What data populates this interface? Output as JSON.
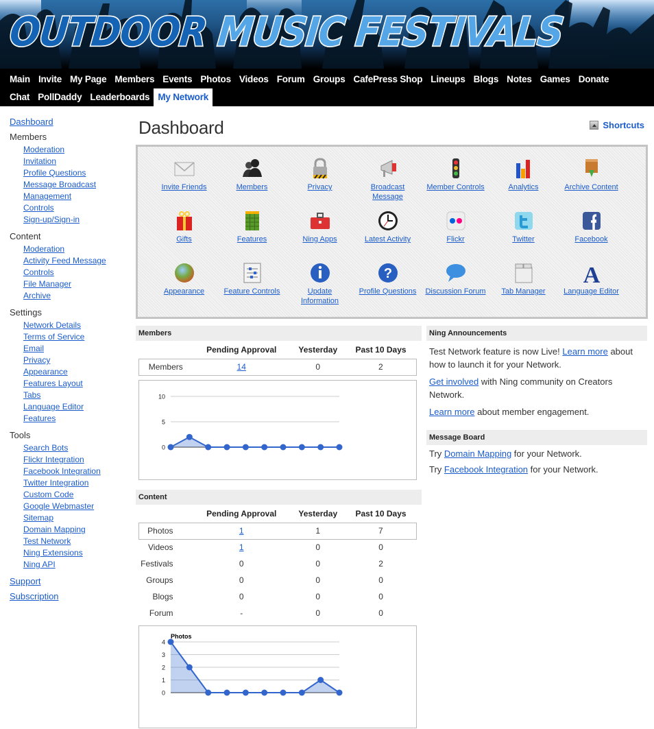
{
  "site": {
    "logo_word1": "OUTDOOR",
    "logo_word2": "MUSIC FESTIVALS",
    "accent_color": "#1a5ccc"
  },
  "nav": {
    "row1": [
      "Main",
      "Invite",
      "My Page",
      "Members",
      "Events",
      "Photos",
      "Videos",
      "Forum",
      "Groups",
      "CafePress Shop",
      "Lineups",
      "Blogs",
      "Notes",
      "Games",
      "Donate"
    ],
    "row2": [
      "Chat",
      "PollDaddy",
      "Leaderboards",
      "My Network"
    ],
    "active": "My Network"
  },
  "sidebar": {
    "dashboard": "Dashboard",
    "sections": [
      {
        "title": "Members",
        "items": [
          "Moderation",
          "Invitation",
          "Profile Questions",
          "Message Broadcast",
          "Management",
          "Controls",
          "Sign-up/Sign-in"
        ]
      },
      {
        "title": "Content",
        "items": [
          "Moderation",
          "Activity Feed Message",
          "Controls",
          "File Manager",
          "Archive"
        ]
      },
      {
        "title": "Settings",
        "items": [
          "Network Details",
          "Terms of Service",
          "Email",
          "Privacy",
          "Appearance",
          "Features Layout",
          "Tabs",
          "Language Editor",
          "Features"
        ]
      },
      {
        "title": "Tools",
        "items": [
          "Search Bots",
          "Flickr Integration",
          "Facebook Integration",
          "Twitter Integration",
          "Custom Code",
          "Google Webmaster",
          "Sitemap",
          "Domain Mapping",
          "Test Network",
          "Ning Extensions",
          "Ning API"
        ]
      }
    ],
    "support": "Support",
    "subscription": "Subscription"
  },
  "main": {
    "title": "Dashboard",
    "shortcuts_label": "Shortcuts",
    "shortcuts": [
      {
        "label": "Invite Friends",
        "icon": "envelope-icon"
      },
      {
        "label": "Members",
        "icon": "people-icon"
      },
      {
        "label": "Privacy",
        "icon": "padlock-icon"
      },
      {
        "label": "Broadcast Message",
        "icon": "megaphone-icon"
      },
      {
        "label": "Member Controls",
        "icon": "traffic-light-icon"
      },
      {
        "label": "Analytics",
        "icon": "bar-chart-icon"
      },
      {
        "label": "Archive Content",
        "icon": "archive-box-icon"
      },
      {
        "label": "Gifts",
        "icon": "gift-icon"
      },
      {
        "label": "Features",
        "icon": "grid-icon"
      },
      {
        "label": "Ning Apps",
        "icon": "toolbox-icon"
      },
      {
        "label": "Latest Activity",
        "icon": "clock-icon"
      },
      {
        "label": "Flickr",
        "icon": "flickr-icon"
      },
      {
        "label": "Twitter",
        "icon": "twitter-icon"
      },
      {
        "label": "Facebook",
        "icon": "facebook-icon"
      },
      {
        "label": "Appearance",
        "icon": "color-orb-icon"
      },
      {
        "label": "Feature Controls",
        "icon": "sliders-icon"
      },
      {
        "label": "Update Information",
        "icon": "info-icon"
      },
      {
        "label": "Profile Questions",
        "icon": "question-icon"
      },
      {
        "label": "Discussion Forum",
        "icon": "speech-bubble-icon"
      },
      {
        "label": "Tab Manager",
        "icon": "tabs-icon"
      },
      {
        "label": "Language Editor",
        "icon": "letter-a-icon"
      }
    ]
  },
  "members_panel": {
    "header": "Members",
    "columns": [
      "Pending Approval",
      "Yesterday",
      "Past 10 Days"
    ],
    "rows": [
      {
        "label": "Members",
        "pending": "14",
        "yesterday": "0",
        "past10": "2",
        "pending_link": true
      }
    ]
  },
  "content_panel": {
    "header": "Content",
    "columns": [
      "Pending Approval",
      "Yesterday",
      "Past 10 Days"
    ],
    "rows": [
      {
        "label": "Photos",
        "pending": "1",
        "yesterday": "1",
        "past10": "7",
        "pending_link": true
      },
      {
        "label": "Videos",
        "pending": "1",
        "yesterday": "0",
        "past10": "0",
        "pending_link": true
      },
      {
        "label": "Festivals",
        "pending": "0",
        "yesterday": "0",
        "past10": "2",
        "pending_link": false
      },
      {
        "label": "Groups",
        "pending": "0",
        "yesterday": "0",
        "past10": "0",
        "pending_link": false
      },
      {
        "label": "Blogs",
        "pending": "0",
        "yesterday": "0",
        "past10": "0",
        "pending_link": false
      },
      {
        "label": "Forum",
        "pending": "-",
        "yesterday": "0",
        "past10": "0",
        "pending_link": false
      }
    ]
  },
  "announcements": {
    "header": "Ning Announcements",
    "p1_text": "Test Network feature is now Live! ",
    "p1_link": "Learn more",
    "p1_rest": " about how to launch it for your Network.",
    "p2_link": "Get involved",
    "p2_rest": " with Ning community on Creators Network.",
    "p3_link": "Learn more",
    "p3_rest": " about member engagement."
  },
  "message_board": {
    "header": "Message Board",
    "m1_pre": "Try ",
    "m1_link": "Domain Mapping",
    "m1_rest": " for your Network.",
    "m2_pre": "Try ",
    "m2_link": "Facebook Integration",
    "m2_rest": " for your Network."
  },
  "chart_data": [
    {
      "type": "area",
      "title": "",
      "x": [
        1,
        2,
        3,
        4,
        5,
        6,
        7,
        8,
        9,
        10
      ],
      "values": [
        0,
        2,
        0,
        0,
        0,
        0,
        0,
        0,
        0,
        0
      ],
      "yticks": [
        "0",
        "5",
        "10"
      ],
      "ylim": [
        0,
        10
      ],
      "grid": true,
      "color": "#3366cc"
    },
    {
      "type": "area",
      "title": "Photos",
      "x": [
        1,
        2,
        3,
        4,
        5,
        6,
        7,
        8,
        9,
        10
      ],
      "values": [
        4,
        2,
        0,
        0,
        0,
        0,
        0,
        0,
        1,
        0
      ],
      "yticks": [
        "0",
        "1",
        "2",
        "3",
        "4"
      ],
      "ylim": [
        0,
        4
      ],
      "grid": true,
      "color": "#3366cc"
    }
  ]
}
